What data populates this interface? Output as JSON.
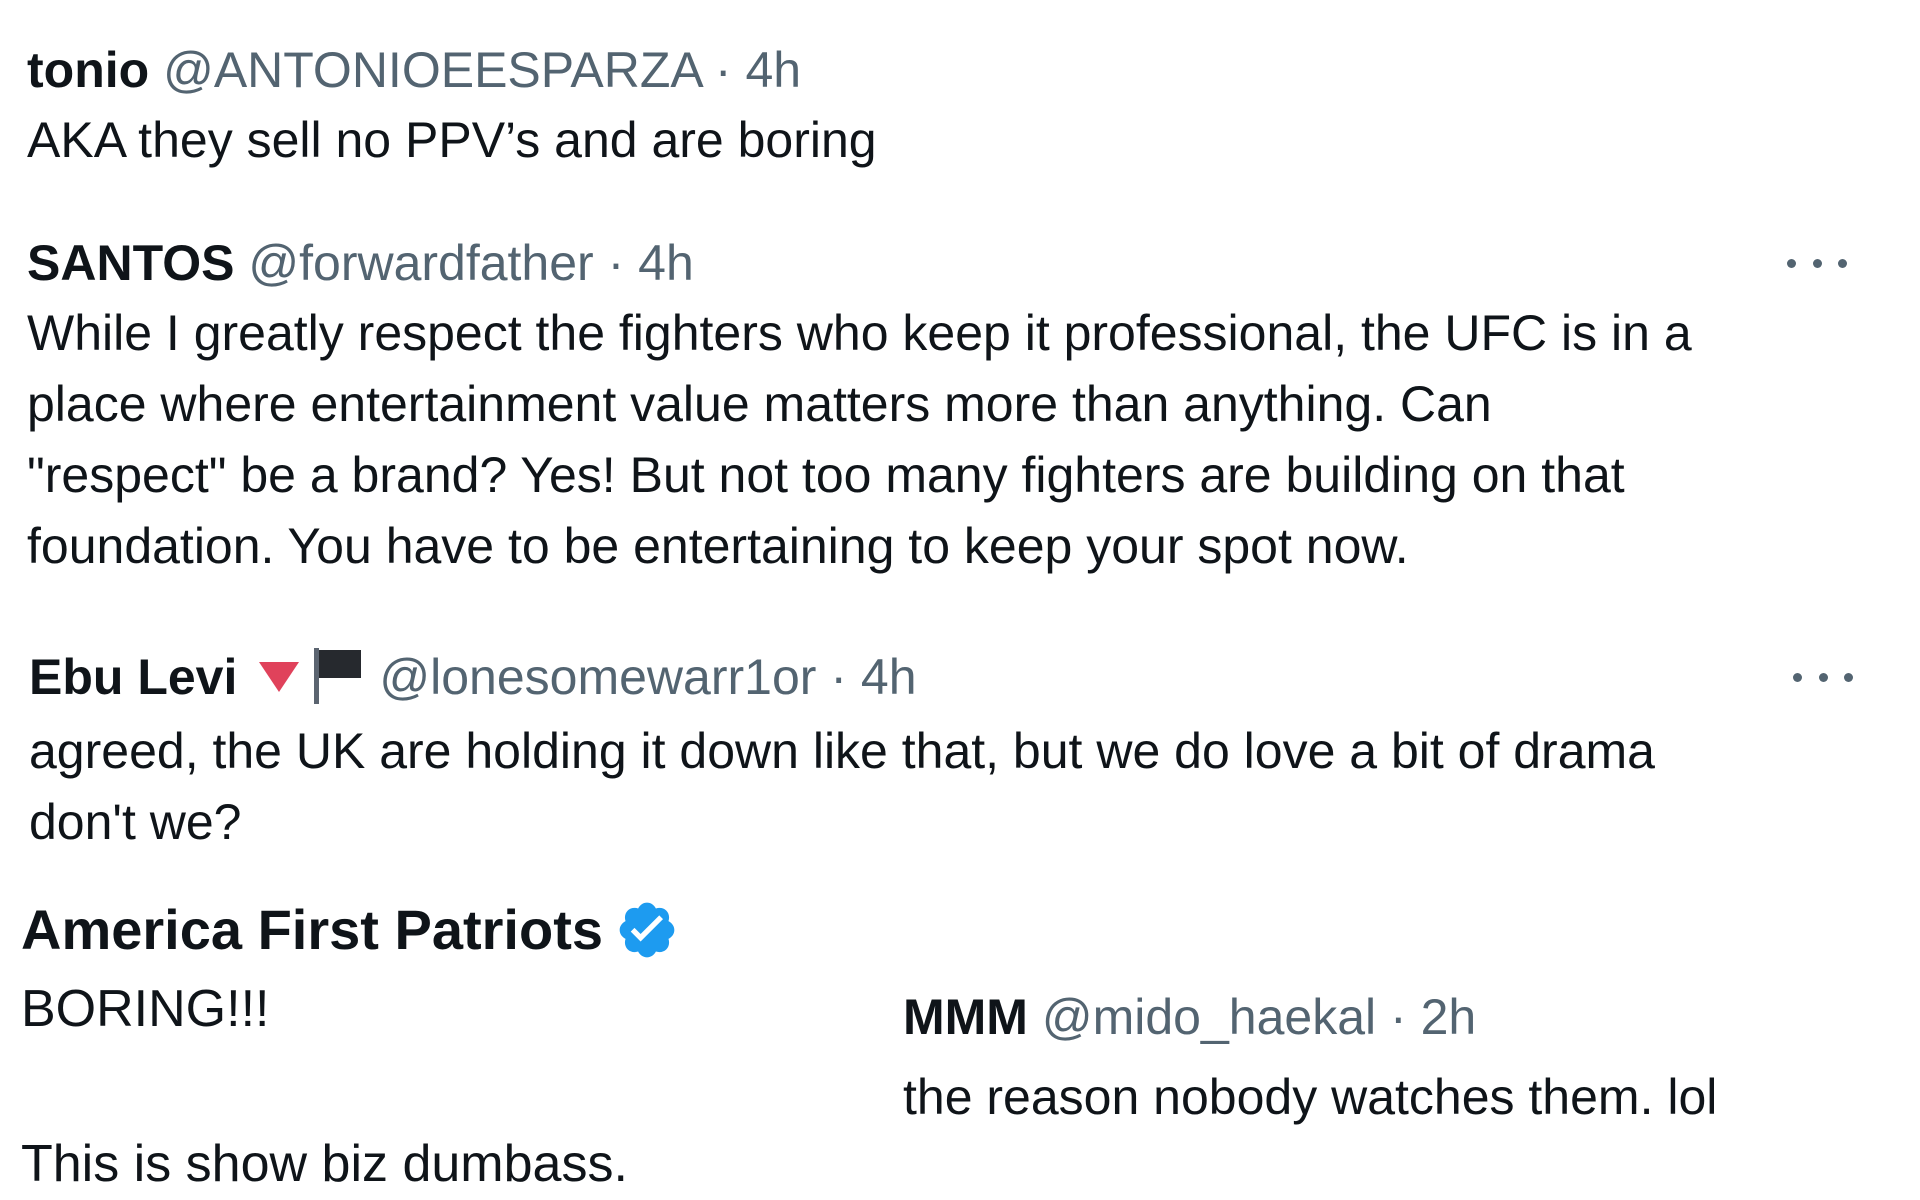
{
  "replies": [
    {
      "name": "tonio",
      "handle": "@ANTONIOEESPARZA",
      "separator": "·",
      "time": "4h",
      "text": "AKA they sell no PPV’s and are boring"
    },
    {
      "name": "SANTOS",
      "handle": "@forwardfather",
      "separator": "·",
      "time": "4h",
      "text_lines": [
        "While I greatly respect the fighters who keep it professional, the UFC is in a",
        "place where entertainment value matters more than anything. Can",
        "\"respect\" be a brand? Yes! But not too many fighters are building on that",
        "foundation. You have to be entertaining to keep your spot now."
      ]
    },
    {
      "name": "Ebu Levi",
      "handle": "@lonesomewarr1or",
      "separator": "·",
      "time": "4h",
      "icons": [
        "red-triangle-down-icon",
        "black-flag-icon"
      ],
      "text_lines": [
        "agreed, the UK are holding it down like that, but we do love a bit of drama",
        "don't we?"
      ]
    },
    {
      "name": "America First Patriots",
      "verified_icon": "verified-badge-icon",
      "text_line1": "BORING!!!",
      "text_line2": "This is show biz dumbass."
    },
    {
      "name": "MMM",
      "handle": "@mido_haekal",
      "separator": "·",
      "time": "2h",
      "text": "the reason nobody watches them. lol"
    }
  ],
  "more_icon": "ellipsis-icon",
  "colors": {
    "text": "#0f1419",
    "secondary": "#536471",
    "verified": "#1d9bf0",
    "triangle": "#e0425b"
  }
}
